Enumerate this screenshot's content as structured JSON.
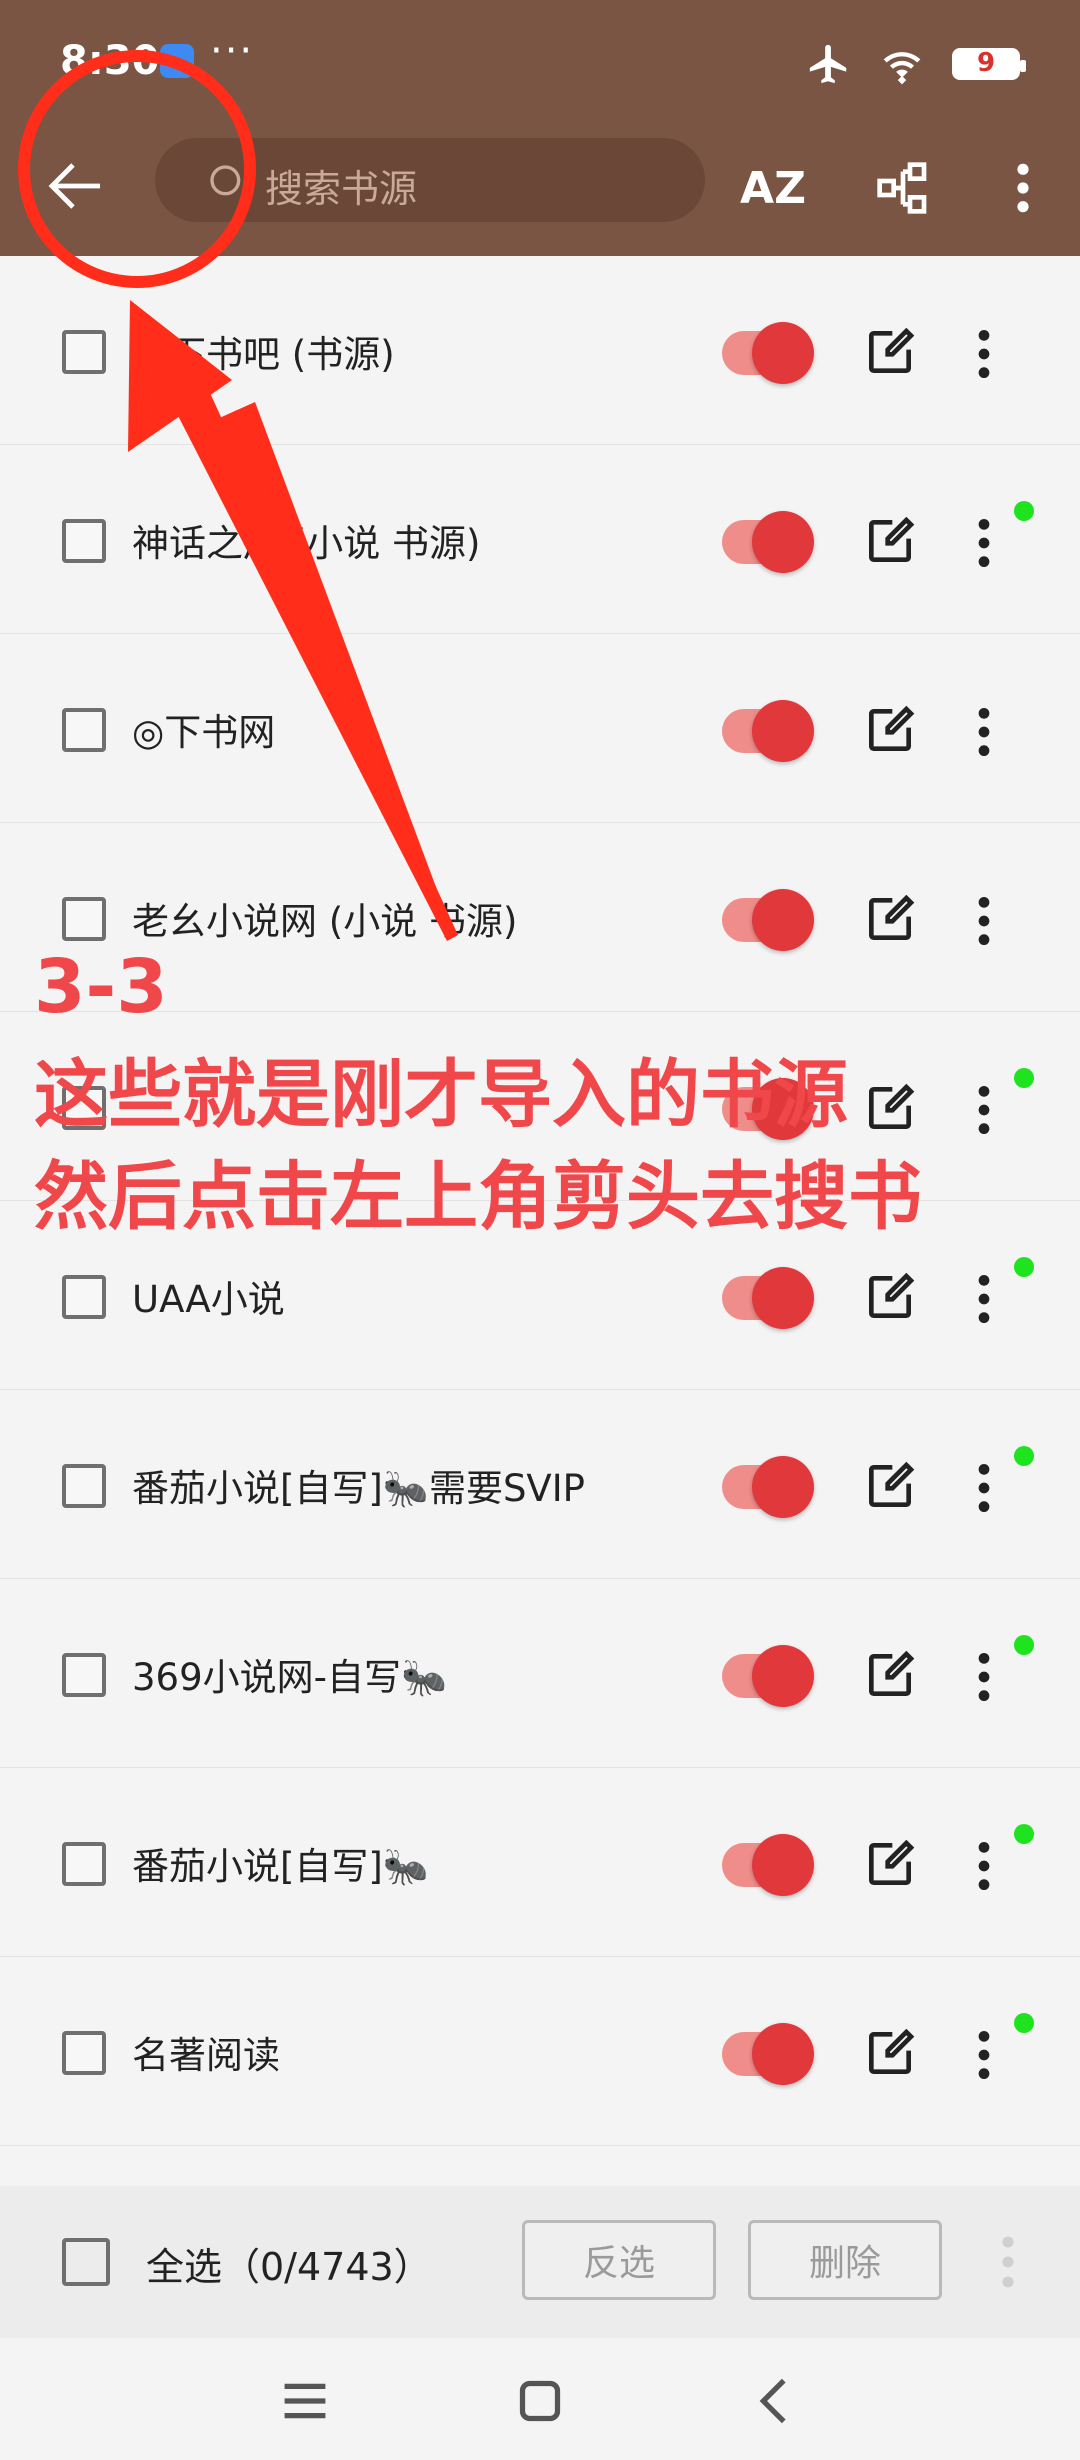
{
  "status": {
    "time": "8:30",
    "battery": "9"
  },
  "appbar": {
    "search_placeholder": "搜索书源",
    "sort_label": "AZ"
  },
  "rows": [
    {
      "name": "爱下书吧 (书源)",
      "dot": false
    },
    {
      "name": "神话之后 (小说 书源)",
      "dot": true
    },
    {
      "name": "◎下书网",
      "dot": false
    },
    {
      "name": "老幺小说网 (小说 书源)",
      "dot": false
    },
    {
      "name": "",
      "dot": true
    },
    {
      "name": "UAA小说",
      "dot": true
    },
    {
      "name": "番茄小说[自写]🐜需要SVIP",
      "dot": true
    },
    {
      "name": "369小说网-自写🐜",
      "dot": true
    },
    {
      "name": "番茄小说[自写]🐜",
      "dot": true
    },
    {
      "name": "名著阅读",
      "dot": true
    }
  ],
  "bottom": {
    "select_all": "全选（0/4743）",
    "invert": "反选",
    "delete": "删除"
  },
  "annotation": {
    "line1": "3-3",
    "line2": "这些就是刚才导入的书源",
    "line3": "然后点击左上角剪头去搜书",
    "color": "#f0474b"
  },
  "colors": {
    "appbar": "#7b5544",
    "toggle_on": "#e0383b",
    "source_active_dot": "#1ee31e"
  }
}
